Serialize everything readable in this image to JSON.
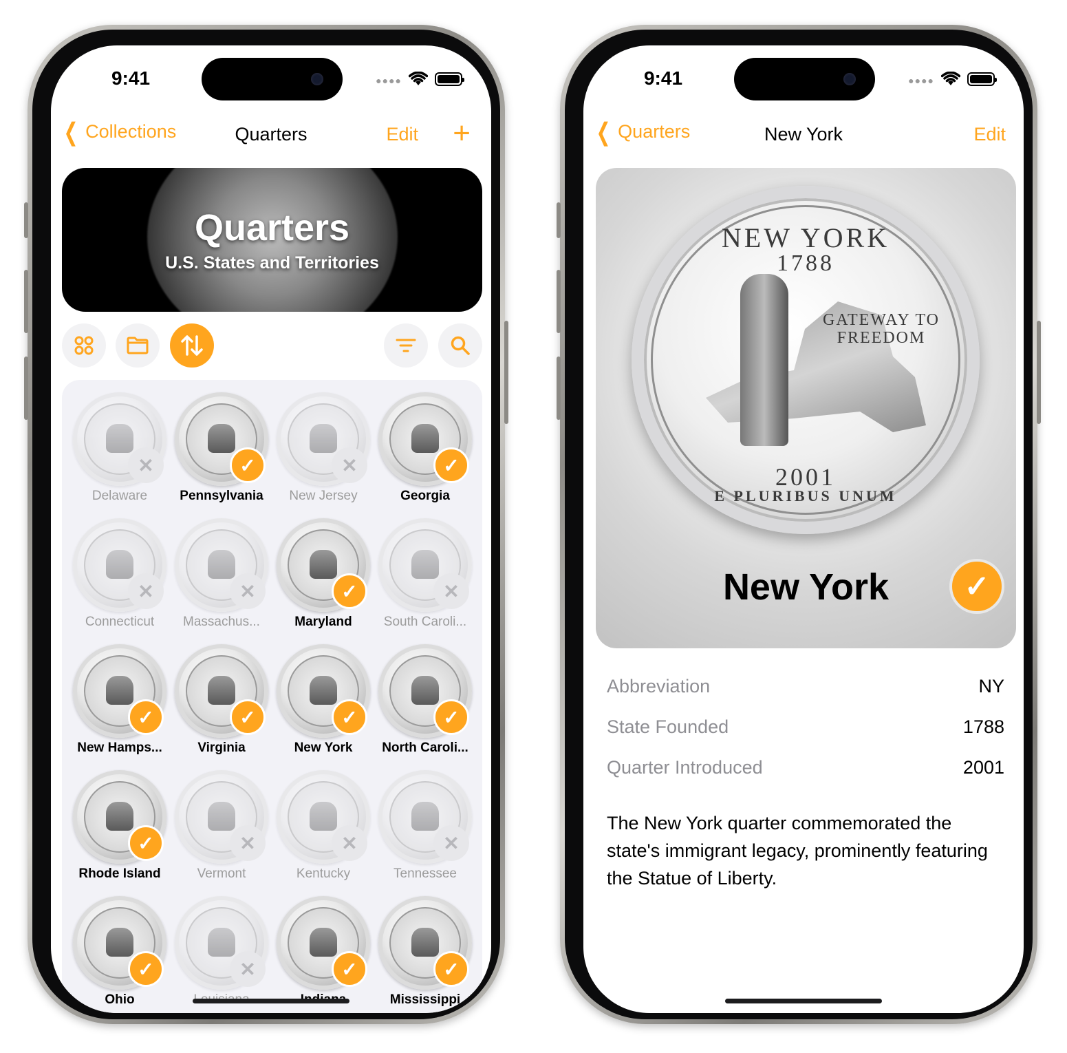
{
  "left_phone": {
    "time": "9:41",
    "nav": {
      "back_label": "Collections",
      "title": "Quarters",
      "edit_label": "Edit",
      "add_label": "+"
    },
    "banner": {
      "title": "Quarters",
      "subtitle": "U.S. States and Territories"
    },
    "toolbar": {
      "grid_icon": "grid-icon",
      "folder_icon": "folder-icon",
      "sort_icon": "sort-icon",
      "filter_icon": "filter-icon",
      "search_icon": "search-icon"
    },
    "coins": [
      {
        "name": "Delaware",
        "collected": false
      },
      {
        "name": "Pennsylvania",
        "collected": true
      },
      {
        "name": "New Jersey",
        "collected": false
      },
      {
        "name": "Georgia",
        "collected": true
      },
      {
        "name": "Connecticut",
        "collected": false
      },
      {
        "name": "Massachus...",
        "collected": false
      },
      {
        "name": "Maryland",
        "collected": true
      },
      {
        "name": "South Caroli...",
        "collected": false
      },
      {
        "name": "New Hamps...",
        "collected": true
      },
      {
        "name": "Virginia",
        "collected": true
      },
      {
        "name": "New York",
        "collected": true
      },
      {
        "name": "North Caroli...",
        "collected": true
      },
      {
        "name": "Rhode Island",
        "collected": true
      },
      {
        "name": "Vermont",
        "collected": false
      },
      {
        "name": "Kentucky",
        "collected": false
      },
      {
        "name": "Tennessee",
        "collected": false
      },
      {
        "name": "Ohio",
        "collected": true
      },
      {
        "name": "Louisiana",
        "collected": false
      },
      {
        "name": "Indiana",
        "collected": true
      },
      {
        "name": "Mississippi",
        "collected": true
      }
    ]
  },
  "right_phone": {
    "time": "9:41",
    "nav": {
      "back_label": "Quarters",
      "title": "New York",
      "edit_label": "Edit"
    },
    "coin": {
      "top_text": "NEW YORK",
      "year_founded_text": "1788",
      "motto_text": "GATEWAY TO FREEDOM",
      "year_text": "2001",
      "bottom_text": "E PLURIBUS UNUM"
    },
    "card_title": "New York",
    "details": [
      {
        "label": "Abbreviation",
        "value": "NY"
      },
      {
        "label": "State Founded",
        "value": "1788"
      },
      {
        "label": "Quarter Introduced",
        "value": "2001"
      }
    ],
    "description": "The New York quarter commemorated the state's immigrant legacy, prominently featuring the Statue of Liberty."
  },
  "colors": {
    "accent": "#FFA51E",
    "secondary_text": "#8e8e93",
    "grid_bg": "#f2f2f7"
  }
}
